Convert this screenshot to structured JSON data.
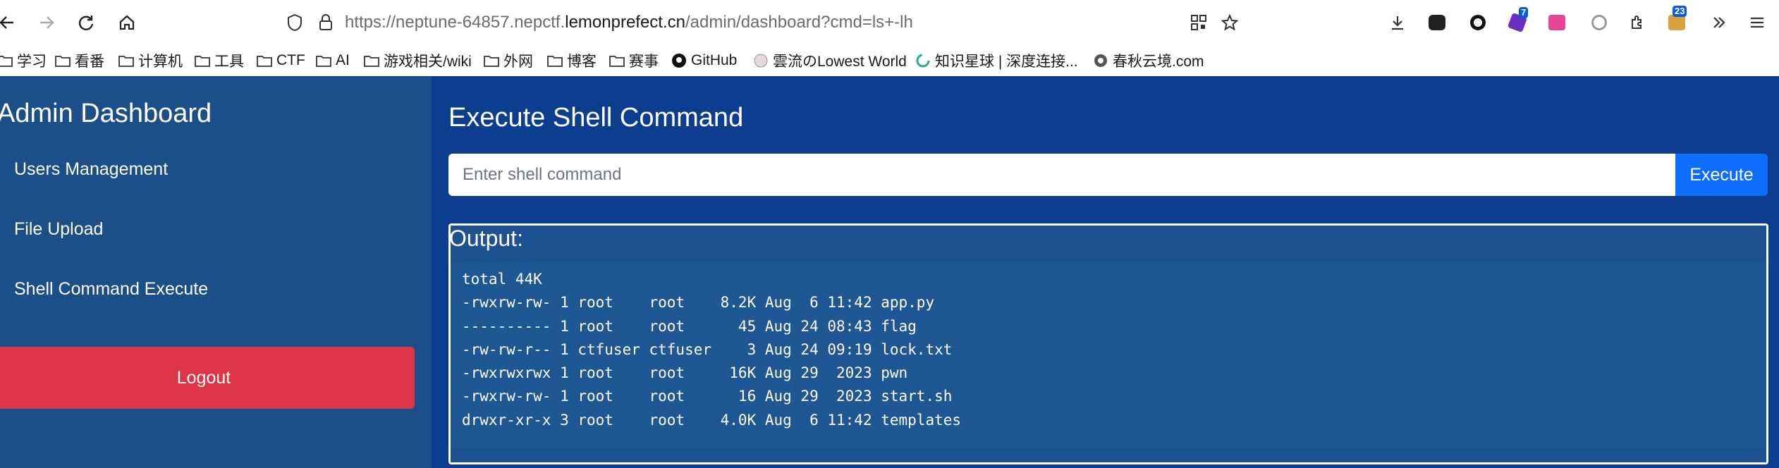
{
  "browser": {
    "url_prefix": "https://neptune-64857.nepctf.",
    "url_host": "lemonprefect.cn",
    "url_path": "/admin/dashboard?cmd=ls+-lh",
    "extension_badges": {
      "ext1": "7",
      "ext2": "23"
    }
  },
  "bookmarks": [
    {
      "label": "学习",
      "icon": "folder-icon"
    },
    {
      "label": "看番",
      "icon": "folder-icon"
    },
    {
      "label": "计算机",
      "icon": "folder-icon"
    },
    {
      "label": "工具",
      "icon": "folder-icon"
    },
    {
      "label": "CTF",
      "icon": "folder-icon"
    },
    {
      "label": "AI",
      "icon": "folder-icon"
    },
    {
      "label": "游戏相关/wiki",
      "icon": "folder-icon"
    },
    {
      "label": "外网",
      "icon": "folder-icon"
    },
    {
      "label": "博客",
      "icon": "folder-icon"
    },
    {
      "label": "赛事",
      "icon": "folder-icon"
    },
    {
      "label": "GitHub",
      "icon": "github-icon"
    },
    {
      "label": "雲流のLowest World",
      "icon": "site-icon"
    },
    {
      "label": "知识星球 | 深度连接...",
      "icon": "zsxq-icon"
    },
    {
      "label": "春秋云境.com",
      "icon": "site-icon"
    }
  ],
  "sidebar": {
    "title": "Admin Dashboard",
    "links": [
      "Users Management",
      "File Upload",
      "Shell Command Execute"
    ],
    "logout_label": "Logout"
  },
  "main": {
    "title": "Execute Shell Command",
    "input_placeholder": "Enter shell command",
    "execute_label": "Execute",
    "output_label": "Output:",
    "output_lines": [
      "total 44K",
      "-rwxrw-rw- 1 root    root    8.2K Aug  6 11:42 app.py",
      "---------- 1 root    root      45 Aug 24 08:43 flag",
      "-rw-rw-r-- 1 ctfuser ctfuser    3 Aug 24 09:19 lock.txt",
      "-rwxrwxrwx 1 root    root     16K Aug 29  2023 pwn",
      "-rwxrw-rw- 1 root    root      16 Aug 29  2023 start.sh",
      "drwxr-xr-x 3 root    root    4.0K Aug  6 11:42 templates"
    ]
  },
  "colors": {
    "sidebar_bg": "#1c4f8a",
    "main_bg": "#0c3d8e",
    "logout_red": "#dc3545",
    "execute_blue": "#0d6efd"
  }
}
